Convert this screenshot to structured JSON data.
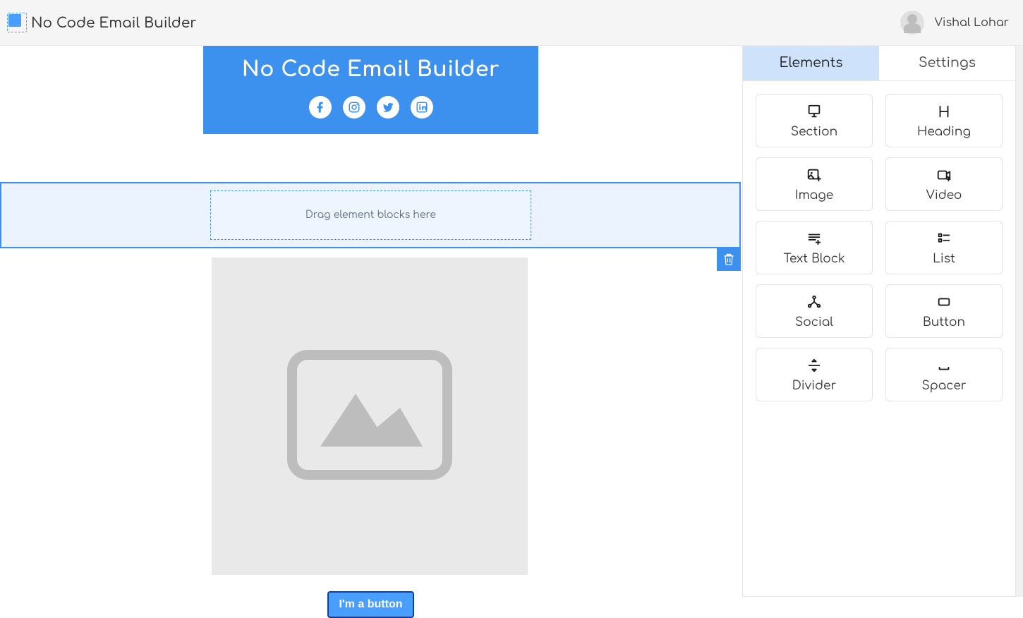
{
  "header": {
    "app_title": "No Code Email Builder",
    "user_name": "Vishal Lohar"
  },
  "canvas": {
    "email_header_title": "No Code Email Builder",
    "social": [
      "facebook",
      "instagram",
      "twitter",
      "linkedin"
    ],
    "dropzone_hint": "Drag element blocks here",
    "button_label": "I'm a button"
  },
  "panel": {
    "tabs": {
      "elements": "Elements",
      "settings": "Settings"
    },
    "active_tab": "elements",
    "elements": [
      {
        "name": "section",
        "label": "Section"
      },
      {
        "name": "heading",
        "label": "Heading"
      },
      {
        "name": "image",
        "label": "Image"
      },
      {
        "name": "video",
        "label": "Video"
      },
      {
        "name": "textblock",
        "label": "Text Block"
      },
      {
        "name": "list",
        "label": "List"
      },
      {
        "name": "social",
        "label": "Social"
      },
      {
        "name": "button",
        "label": "Button"
      },
      {
        "name": "divider",
        "label": "Divider"
      },
      {
        "name": "spacer",
        "label": "Spacer"
      }
    ]
  },
  "colors": {
    "primary": "#3d91ee",
    "accent": "#4a9eff"
  }
}
